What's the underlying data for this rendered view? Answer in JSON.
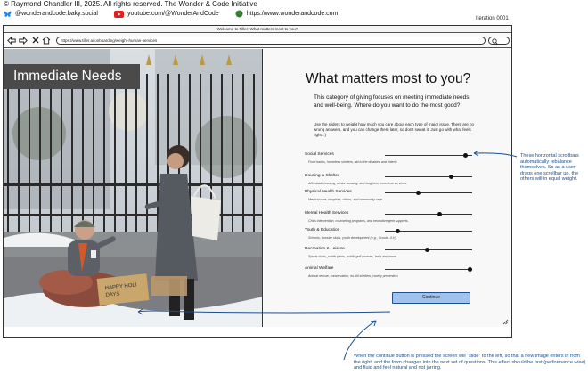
{
  "credits": {
    "copyright": "© Raymond Chandler III, 2025. All rights reserved. The Wonder & Code Initiative",
    "bluesky": "@wonderandcode.baky.social",
    "youtube": "youtube.com/@WonderAndCode",
    "website": "https://www.wonderandcode.com"
  },
  "iteration": "Iteration 0001",
  "browser": {
    "title": "Welcome to Tiller: What matters most to you?",
    "url": "https://www.tiller.ai/onboarding/weight-human-services"
  },
  "hero": {
    "label": "Immediate Needs"
  },
  "form": {
    "title": "What matters most to you?",
    "intro": "This category of giving focuses on meeting immediate needs and well-being. Where do you want to do the most good?",
    "instructions": "Use the sliders to weight how much you care about each type of major issue. There are no wrong answers, and you can change them later, so don't sweat it. Just go with what feels right. :)",
    "categories": [
      {
        "name": "Social Services",
        "description": "Food banks, homeless shelters, aid to the disabled and elderly.",
        "weight": 0.92
      },
      {
        "name": "Housing & Shelter",
        "description": "Affordable housing, senior housing, and long term homeless services.",
        "weight": 0.76
      },
      {
        "name": "Physical Health Services",
        "description": "Medical care, hospitals, clinics, and community care.",
        "weight": 0.38
      },
      {
        "name": "Mental Health Services",
        "description": "Crisis intervention, counseling programs, and neurodivergent supports.",
        "weight": 0.63
      },
      {
        "name": "Youth & Education",
        "description": "Schools, booster clubs, youth development (e.g., Scouts, 4-H).",
        "weight": 0.15
      },
      {
        "name": "Recreation & Leisure",
        "description": "Sports clubs, public parks, public golf courses, trails and more.",
        "weight": 0.48
      },
      {
        "name": "Animal Welfare",
        "description": "Animal rescue, conservation, no-kill shelters, cruelty prevention.",
        "weight": 0.97
      }
    ],
    "continue_label": "Continue"
  },
  "annotations": {
    "sliders_note": "These horizontal scrollbars automatically rebalance themselves. So as a user drags one scrollbar up, the others will in equal weight.",
    "continue_note": "When the continue button is pressed the screen will \"slide\" to the left, so that a new image enters in from the right, and the form changes into the next set of questions. This effect should be fast (performance wise) and fluid and feel natural and not jarring."
  },
  "colors": {
    "accent": "#1b4f8f",
    "button": "#9fc3ec",
    "hero_label_bg": "#4a4a4a",
    "youtube": "#e02020",
    "bluesky": "#1185fe"
  }
}
